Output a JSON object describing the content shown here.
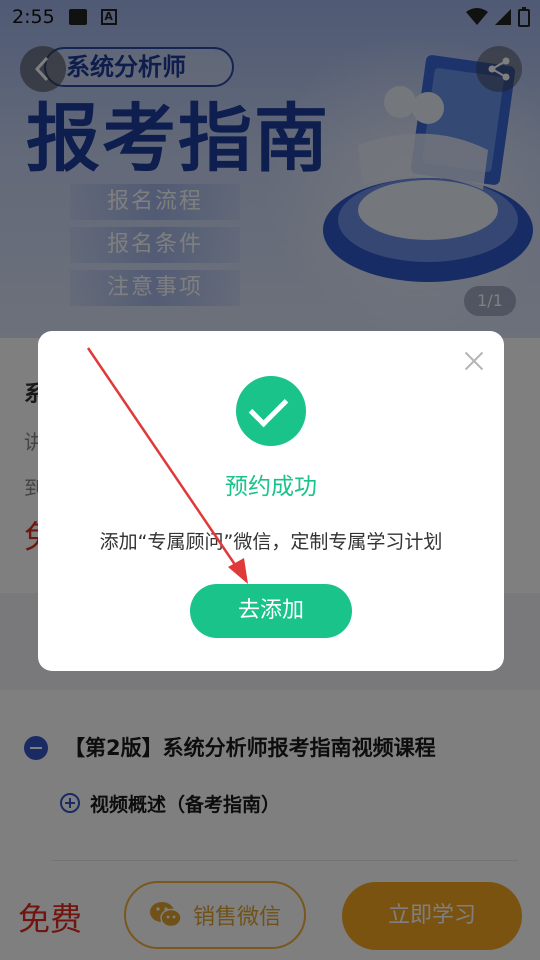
{
  "status_bar": {
    "time": "2:55",
    "icons": [
      "image-icon",
      "font-a-icon",
      "wifi-icon",
      "signal-icon",
      "battery-icon"
    ]
  },
  "banner": {
    "subject": "系统分析师",
    "title": "报考指南",
    "menu": [
      "报名流程",
      "报名条件",
      "注意事项"
    ],
    "page_indicator": "1/1",
    "accent": "#1d3c9c"
  },
  "course": {
    "title": "【第2版】系统分析师报考指南视频课程",
    "subitem": "视频概述（备考指南）"
  },
  "bottom_bar": {
    "free_label": "免费",
    "wechat_label": "销售微信",
    "study_label": "立即学习"
  },
  "dialog": {
    "title": "预约成功",
    "message": "添加“专属顾问”微信，定制专属学习计划",
    "button": "去添加",
    "accent": "#19c38a"
  }
}
